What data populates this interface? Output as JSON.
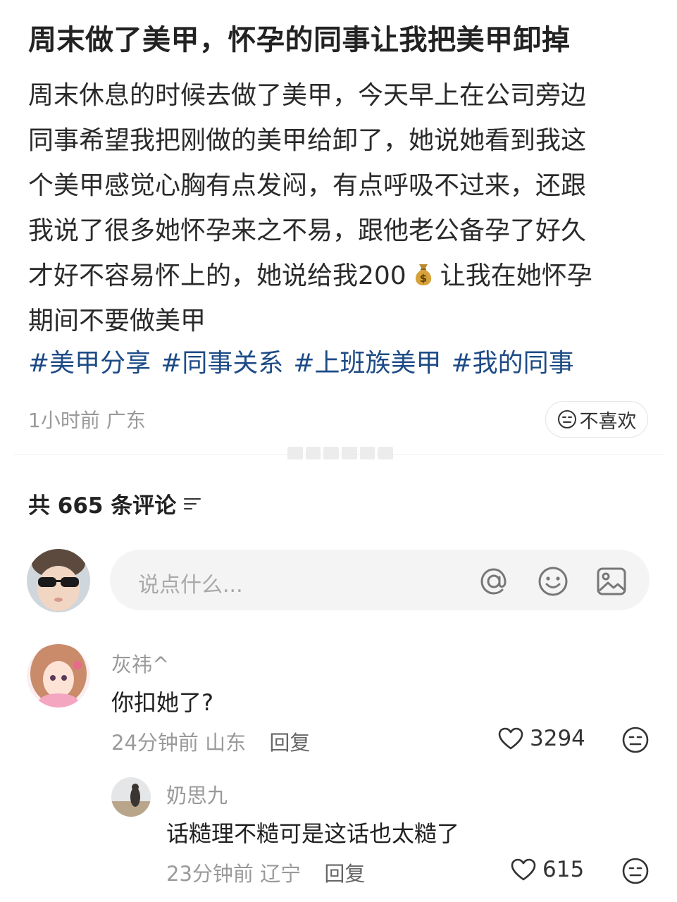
{
  "post": {
    "title": "周末做了美甲，怀孕的同事让我把美甲卸掉",
    "body_before_emoji": "周末休息的时候去做了美甲，今天早上在公司旁边\n同事希望我把刚做的美甲给卸了，她说她看到我这\n个美甲感觉心胸有点发闷，有点呼吸不过来，还跟\n我说了很多她怀孕来之不易，跟他老公备孕了好久\n才好不容易怀上的，她说给我200",
    "body_after_emoji_line": "让我在她怀孕",
    "body_last_line": "期间不要做美甲",
    "money_bag_icon": "money-bag-icon",
    "tags": [
      "#美甲分享",
      "#同事关系",
      "#上班族美甲",
      "#我的同事"
    ],
    "time": "1小时前",
    "location": "广东",
    "dislike_label": "不喜欢",
    "tag_color": "#1d4b86"
  },
  "comments_header": {
    "count_text": "共 665 条评论"
  },
  "comment_input": {
    "placeholder": "说点什么..."
  },
  "comments": [
    {
      "name": "灰祎^",
      "text": "你扣她了?",
      "time": "24分钟前",
      "location": "山东",
      "reply_label": "回复",
      "likes": "3294"
    },
    {
      "name": "奶思九",
      "text": "话糙理不糙可是这话也太糙了",
      "time": "23分钟前",
      "location": "辽宁",
      "reply_label": "回复",
      "likes": "615"
    }
  ]
}
